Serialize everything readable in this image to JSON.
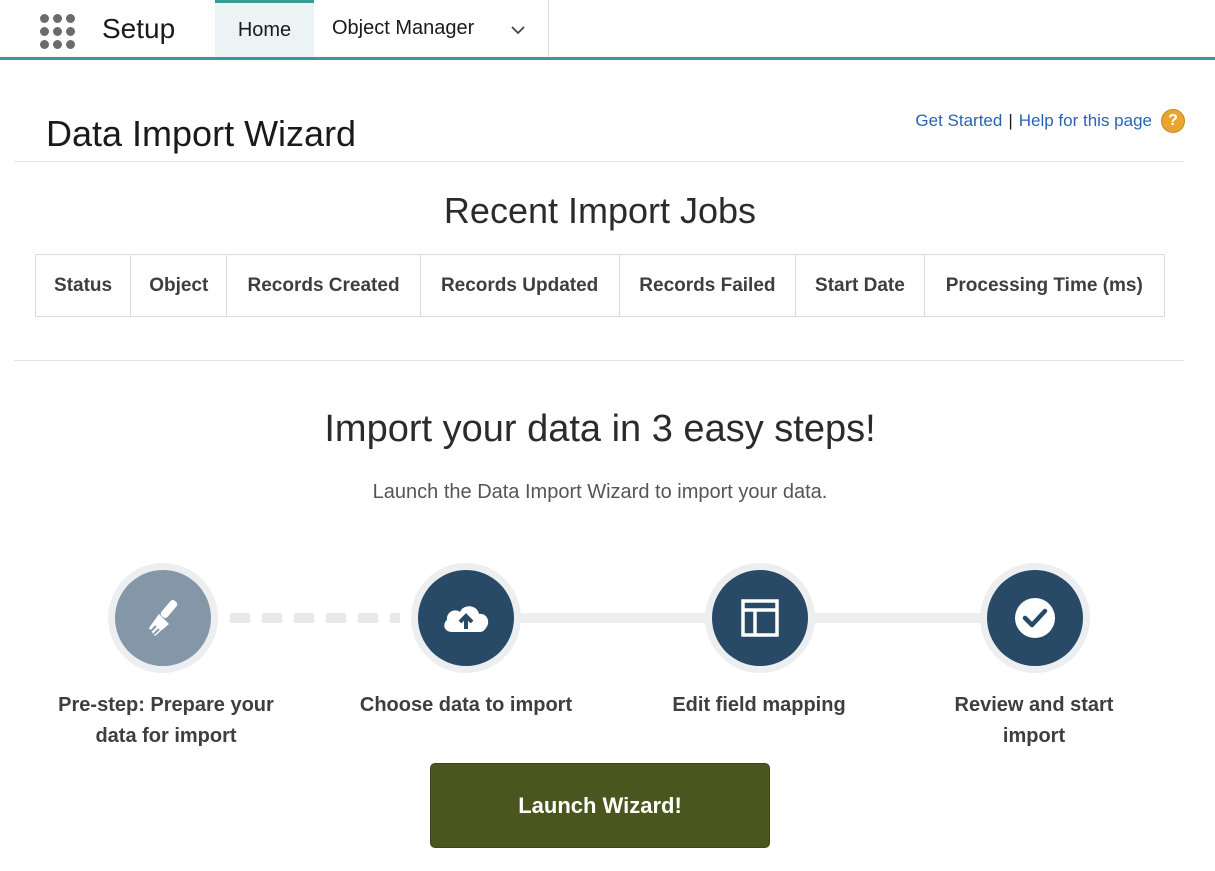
{
  "header": {
    "app_title": "Setup",
    "tabs": [
      {
        "label": "Home",
        "active": true
      },
      {
        "label": "Object Manager",
        "active": false
      }
    ]
  },
  "page": {
    "title": "Data Import Wizard",
    "links": {
      "get_started": "Get Started",
      "separator": "|",
      "help": "Help for this page"
    }
  },
  "recent_jobs": {
    "title": "Recent Import Jobs",
    "columns": [
      "Status",
      "Object",
      "Records Created",
      "Records Updated",
      "Records Failed",
      "Start Date",
      "Processing Time (ms)"
    ]
  },
  "steps_section": {
    "heading": "Import your data in 3 easy steps!",
    "subtitle": "Launch the Data Import Wizard to import your data.",
    "steps": [
      {
        "label": "Pre-step: Prepare your data for import",
        "icon": "brush-icon"
      },
      {
        "label": "Choose data to import",
        "icon": "cloud-upload-icon"
      },
      {
        "label": "Edit field mapping",
        "icon": "layout-icon"
      },
      {
        "label": "Review and start import",
        "icon": "checkmark-icon"
      }
    ]
  },
  "launch_button": "Launch Wizard!",
  "colors": {
    "accent": "#3c9a92",
    "navy": "#284a67",
    "grey_step": "#8497a8",
    "launch": "#4a561d",
    "link": "#2a63b5"
  }
}
